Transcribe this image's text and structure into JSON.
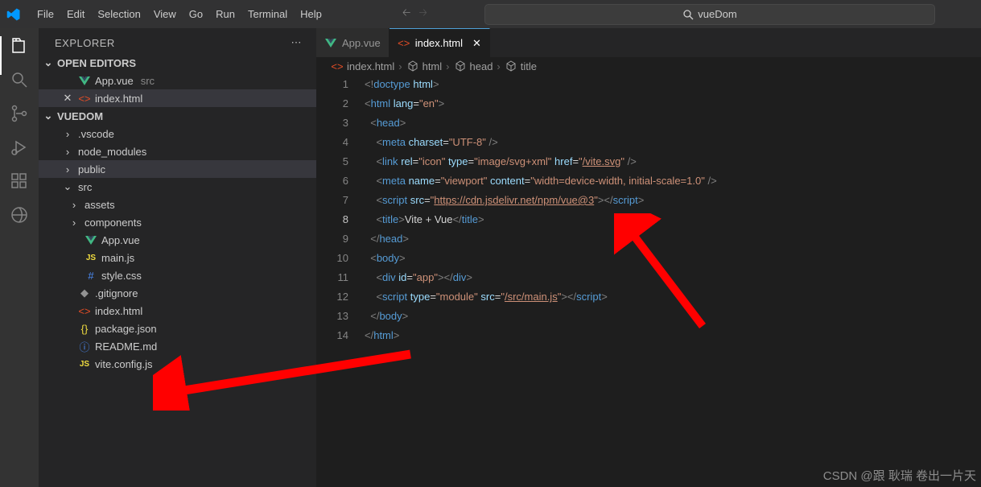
{
  "menu": [
    "File",
    "Edit",
    "Selection",
    "View",
    "Go",
    "Run",
    "Terminal",
    "Help"
  ],
  "search": {
    "icon": "search",
    "text": "vueDom"
  },
  "explorer": {
    "title": "EXPLORER",
    "openEditors": {
      "label": "OPEN EDITORS",
      "items": [
        {
          "icon": "vue",
          "name": "App.vue",
          "dim": "src",
          "closeable": false
        },
        {
          "icon": "html",
          "name": "index.html",
          "dim": "",
          "closeable": true,
          "active": true
        }
      ]
    },
    "project": {
      "label": "VUEDOM",
      "tree": [
        {
          "type": "folder",
          "name": ".vscode",
          "expanded": false,
          "level": 1
        },
        {
          "type": "folder",
          "name": "node_modules",
          "expanded": false,
          "level": 1
        },
        {
          "type": "folder",
          "name": "public",
          "expanded": false,
          "level": 1,
          "selected": true
        },
        {
          "type": "folder",
          "name": "src",
          "expanded": true,
          "level": 1
        },
        {
          "type": "folder",
          "name": "assets",
          "expanded": false,
          "level": 2
        },
        {
          "type": "folder",
          "name": "components",
          "expanded": false,
          "level": 2
        },
        {
          "type": "file",
          "icon": "vue",
          "name": "App.vue",
          "level": 2
        },
        {
          "type": "file",
          "icon": "js",
          "name": "main.js",
          "level": 2
        },
        {
          "type": "file",
          "icon": "css",
          "name": "style.css",
          "level": 2
        },
        {
          "type": "file",
          "icon": "git",
          "name": ".gitignore",
          "level": 1
        },
        {
          "type": "file",
          "icon": "html",
          "name": "index.html",
          "level": 1
        },
        {
          "type": "file",
          "icon": "json",
          "name": "package.json",
          "level": 1
        },
        {
          "type": "file",
          "icon": "info",
          "name": "README.md",
          "level": 1
        },
        {
          "type": "file",
          "icon": "js",
          "name": "vite.config.js",
          "level": 1
        }
      ]
    }
  },
  "tabs": [
    {
      "icon": "vue",
      "label": "App.vue",
      "active": false
    },
    {
      "icon": "html",
      "label": "index.html",
      "active": true,
      "closeable": true
    }
  ],
  "breadcrumbs": [
    {
      "icon": "html",
      "label": "index.html"
    },
    {
      "icon": "cube",
      "label": "html"
    },
    {
      "icon": "cube",
      "label": "head"
    },
    {
      "icon": "cube",
      "label": "title"
    }
  ],
  "code": {
    "currentLine": 8,
    "lines": [
      {
        "n": 1,
        "seg": [
          [
            "bracket",
            "<!"
          ],
          [
            "doctype",
            "doctype"
          ],
          [
            "text",
            " "
          ],
          [
            "attr",
            "html"
          ],
          [
            "bracket",
            ">"
          ]
        ]
      },
      {
        "n": 2,
        "seg": [
          [
            "bracket",
            "<"
          ],
          [
            "tag",
            "html"
          ],
          [
            "text",
            " "
          ],
          [
            "attr",
            "lang"
          ],
          [
            "text",
            "="
          ],
          [
            "string",
            "\"en\""
          ],
          [
            "bracket",
            ">"
          ]
        ]
      },
      {
        "n": 3,
        "seg": [
          [
            "text",
            "  "
          ],
          [
            "bracket",
            "<"
          ],
          [
            "tag",
            "head"
          ],
          [
            "bracket",
            ">"
          ]
        ]
      },
      {
        "n": 4,
        "seg": [
          [
            "text",
            "    "
          ],
          [
            "bracket",
            "<"
          ],
          [
            "tag",
            "meta"
          ],
          [
            "text",
            " "
          ],
          [
            "attr",
            "charset"
          ],
          [
            "text",
            "="
          ],
          [
            "string",
            "\"UTF-8\""
          ],
          [
            "text",
            " "
          ],
          [
            "bracket",
            "/>"
          ]
        ]
      },
      {
        "n": 5,
        "seg": [
          [
            "text",
            "    "
          ],
          [
            "bracket",
            "<"
          ],
          [
            "tag",
            "link"
          ],
          [
            "text",
            " "
          ],
          [
            "attr",
            "rel"
          ],
          [
            "text",
            "="
          ],
          [
            "string",
            "\"icon\""
          ],
          [
            "text",
            " "
          ],
          [
            "attr",
            "type"
          ],
          [
            "text",
            "="
          ],
          [
            "string",
            "\"image/svg+xml\""
          ],
          [
            "text",
            " "
          ],
          [
            "attr",
            "href"
          ],
          [
            "text",
            "="
          ],
          [
            "string",
            "\""
          ],
          [
            "link",
            "/vite.svg"
          ],
          [
            "string",
            "\""
          ],
          [
            "text",
            " "
          ],
          [
            "bracket",
            "/>"
          ]
        ]
      },
      {
        "n": 6,
        "seg": [
          [
            "text",
            "    "
          ],
          [
            "bracket",
            "<"
          ],
          [
            "tag",
            "meta"
          ],
          [
            "text",
            " "
          ],
          [
            "attr",
            "name"
          ],
          [
            "text",
            "="
          ],
          [
            "string",
            "\"viewport\""
          ],
          [
            "text",
            " "
          ],
          [
            "attr",
            "content"
          ],
          [
            "text",
            "="
          ],
          [
            "string",
            "\"width=device-width, initial-scale=1.0\""
          ],
          [
            "text",
            " "
          ],
          [
            "bracket",
            "/>"
          ]
        ]
      },
      {
        "n": 7,
        "seg": [
          [
            "text",
            "    "
          ],
          [
            "bracket",
            "<"
          ],
          [
            "tag",
            "script"
          ],
          [
            "text",
            " "
          ],
          [
            "attr",
            "src"
          ],
          [
            "text",
            "="
          ],
          [
            "string",
            "\""
          ],
          [
            "link",
            "https://cdn.jsdelivr.net/npm/vue@3"
          ],
          [
            "string",
            "\""
          ],
          [
            "bracket",
            "></"
          ],
          [
            "tag",
            "script"
          ],
          [
            "bracket",
            ">"
          ]
        ]
      },
      {
        "n": 8,
        "seg": [
          [
            "text",
            "    "
          ],
          [
            "bracket",
            "<"
          ],
          [
            "tag",
            "title"
          ],
          [
            "bracket",
            ">"
          ],
          [
            "text",
            "Vite + Vue"
          ],
          [
            "bracket",
            "</"
          ],
          [
            "tag",
            "title"
          ],
          [
            "bracket",
            ">"
          ]
        ]
      },
      {
        "n": 9,
        "seg": [
          [
            "text",
            "  "
          ],
          [
            "bracket",
            "</"
          ],
          [
            "tag",
            "head"
          ],
          [
            "bracket",
            ">"
          ]
        ]
      },
      {
        "n": 10,
        "seg": [
          [
            "text",
            "  "
          ],
          [
            "bracket",
            "<"
          ],
          [
            "tag",
            "body"
          ],
          [
            "bracket",
            ">"
          ]
        ]
      },
      {
        "n": 11,
        "seg": [
          [
            "text",
            "    "
          ],
          [
            "bracket",
            "<"
          ],
          [
            "tag",
            "div"
          ],
          [
            "text",
            " "
          ],
          [
            "attr",
            "id"
          ],
          [
            "text",
            "="
          ],
          [
            "string",
            "\"app\""
          ],
          [
            "bracket",
            "></"
          ],
          [
            "tag",
            "div"
          ],
          [
            "bracket",
            ">"
          ]
        ]
      },
      {
        "n": 12,
        "seg": [
          [
            "text",
            "    "
          ],
          [
            "bracket",
            "<"
          ],
          [
            "tag",
            "script"
          ],
          [
            "text",
            " "
          ],
          [
            "attr",
            "type"
          ],
          [
            "text",
            "="
          ],
          [
            "string",
            "\"module\""
          ],
          [
            "text",
            " "
          ],
          [
            "attr",
            "src"
          ],
          [
            "text",
            "="
          ],
          [
            "string",
            "\""
          ],
          [
            "link",
            "/src/main.js"
          ],
          [
            "string",
            "\""
          ],
          [
            "bracket",
            "></"
          ],
          [
            "tag",
            "script"
          ],
          [
            "bracket",
            ">"
          ]
        ]
      },
      {
        "n": 13,
        "seg": [
          [
            "text",
            "  "
          ],
          [
            "bracket",
            "</"
          ],
          [
            "tag",
            "body"
          ],
          [
            "bracket",
            ">"
          ]
        ]
      },
      {
        "n": 14,
        "seg": [
          [
            "bracket",
            "</"
          ],
          [
            "tag",
            "html"
          ],
          [
            "bracket",
            ">"
          ]
        ]
      }
    ]
  },
  "watermark": "CSDN @跟 耿瑞 卷出一片天"
}
